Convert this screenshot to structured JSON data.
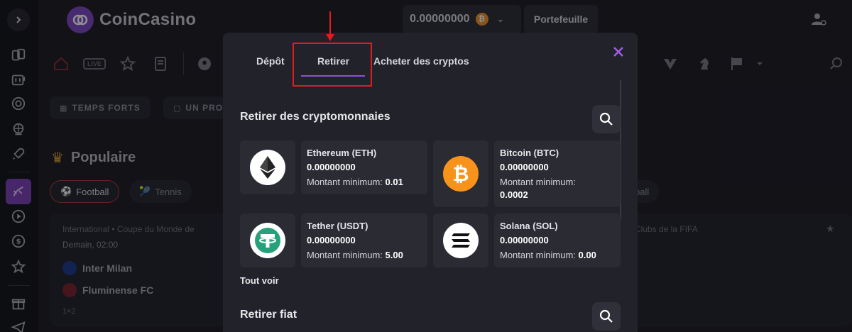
{
  "header": {
    "logo_text": "CoinCasino",
    "balance": "0.00000000",
    "wallet_label": "Portefeuille"
  },
  "background": {
    "chips": [
      "TEMPS FORTS",
      "UN PRO",
      "Football",
      "Tennis",
      "ball"
    ],
    "popular_title": "Populaire",
    "match": {
      "competition": "International • Coupe du Monde de",
      "time": "Demain, 02:00",
      "team_home": "Inter Milan",
      "team_away": "Fluminense FC",
      "odds_label": "1×2",
      "right_competition": "Clubs de la FIFA"
    }
  },
  "modal": {
    "tabs": [
      "Dépôt",
      "Retirer",
      "Acheter des cryptos"
    ],
    "active_tab": "Retirer",
    "crypto_section_title": "Retirer des cryptomonnaies",
    "fiat_section_title": "Retirer fiat",
    "see_all": "Tout voir",
    "min_label": "Montant minimum:",
    "coins": [
      {
        "name": "Ethereum (ETH)",
        "amount": "0.00000000",
        "min": "0.01",
        "color": "#ffffff"
      },
      {
        "name": "Bitcoin (BTC)",
        "amount": "0.00000000",
        "min": "0.0002",
        "color": "#f7931a"
      },
      {
        "name": "Tether (USDT)",
        "amount": "0.00000000",
        "min": "5.00",
        "color": "#ffffff"
      },
      {
        "name": "Solana (SOL)",
        "amount": "0.00000000",
        "min": "0.00",
        "color": "#ffffff"
      }
    ]
  },
  "colors": {
    "accent": "#8d4fe0",
    "highlight": "#e01c1c",
    "background": "#1a1b22",
    "modal": "#22232a"
  }
}
